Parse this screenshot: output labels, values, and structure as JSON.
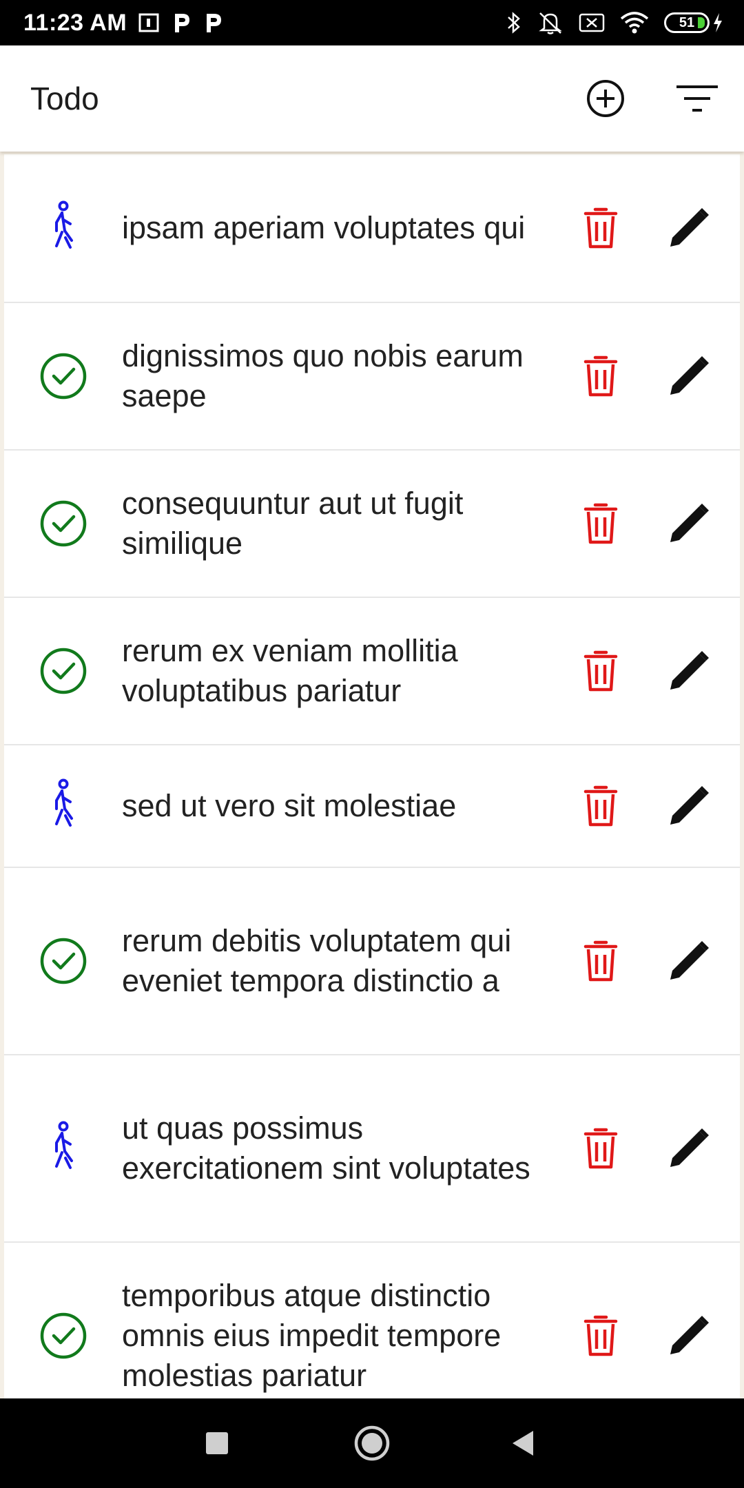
{
  "status_bar": {
    "time": "11:23 AM",
    "battery_level": "51"
  },
  "app_bar": {
    "title": "Todo",
    "actions": [
      "add-circle-icon",
      "filter-icon"
    ]
  },
  "colors": {
    "done": "#117a1c",
    "in_progress": "#1a1ae6",
    "delete": "#e01818",
    "edit": "#111111"
  },
  "todos": [
    {
      "text": "ipsam aperiam voluptates qui",
      "status": "in-progress",
      "status_icon": "walking-person-icon"
    },
    {
      "text": "dignissimos quo nobis earum saepe",
      "status": "done",
      "status_icon": "check-circle-icon"
    },
    {
      "text": "consequuntur aut ut fugit similique",
      "status": "done",
      "status_icon": "check-circle-icon"
    },
    {
      "text": "rerum ex veniam mollitia voluptatibus pariatur",
      "status": "done",
      "status_icon": "check-circle-icon"
    },
    {
      "text": "sed ut vero sit molestiae",
      "status": "in-progress",
      "status_icon": "walking-person-icon"
    },
    {
      "text": "rerum debitis voluptatem qui eveniet tempora distinctio a",
      "status": "done",
      "status_icon": "check-circle-icon"
    },
    {
      "text": "ut quas possimus exercitationem sint voluptates",
      "status": "in-progress",
      "status_icon": "walking-person-icon"
    },
    {
      "text": "temporibus atque distinctio omnis eius impedit tempore molestias pariatur",
      "status": "done",
      "status_icon": "check-circle-icon"
    }
  ],
  "nav_bar": {
    "buttons": [
      "recents-icon",
      "home-icon",
      "back-icon"
    ]
  }
}
